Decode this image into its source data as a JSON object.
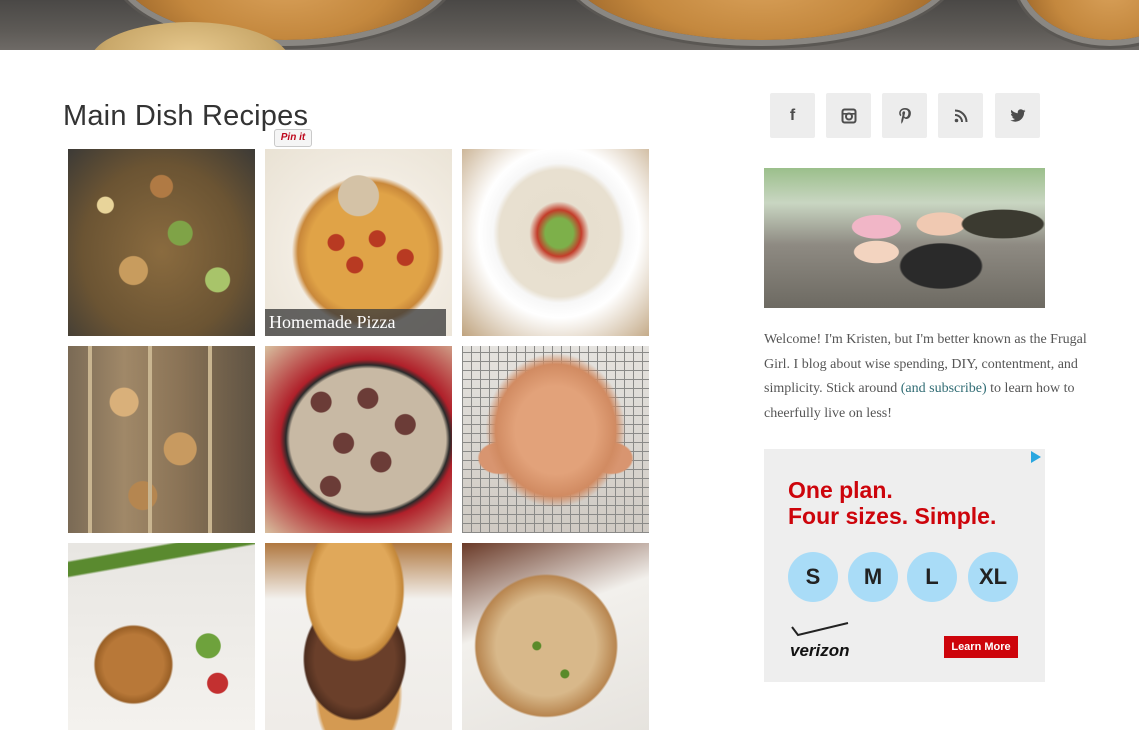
{
  "page": {
    "section_title": "Main Dish Recipes",
    "pin_label": "Pin it"
  },
  "recipes": [
    {
      "name": "zucchini-chicken-skillet-tile",
      "caption": ""
    },
    {
      "name": "homemade-pizza-tile",
      "caption": "Homemade Pizza"
    },
    {
      "name": "tostada-tile",
      "caption": ""
    },
    {
      "name": "chicken-kabobs-tile",
      "caption": ""
    },
    {
      "name": "meatballs-skillet-tile",
      "caption": ""
    },
    {
      "name": "roast-chicken-tile",
      "caption": ""
    },
    {
      "name": "salmon-cakes-tile",
      "caption": ""
    },
    {
      "name": "pulled-pork-sandwich-tile",
      "caption": ""
    },
    {
      "name": "sliced-chicken-tile",
      "caption": ""
    }
  ],
  "social": {
    "facebook": "f",
    "instagram": "◙",
    "pinterest": "P",
    "rss": "))",
    "twitter": "t"
  },
  "sidebar": {
    "welcome_before": "Welcome! I'm Kristen, but I'm better known as the Frugal Girl. I blog about wise spending, DIY, contentment, and simplicity. Stick around ",
    "welcome_link": "(and subscribe)",
    "welcome_after": " to learn how to cheerfully live on less!"
  },
  "ad": {
    "headline_1": "One plan.",
    "headline_2": "Four sizes. Simple.",
    "sizes": [
      "S",
      "M",
      "L",
      "XL"
    ],
    "brand": "verizon",
    "cta": "Learn More",
    "accent_color": "#cd040b",
    "size_color": "#a9dcf7"
  }
}
